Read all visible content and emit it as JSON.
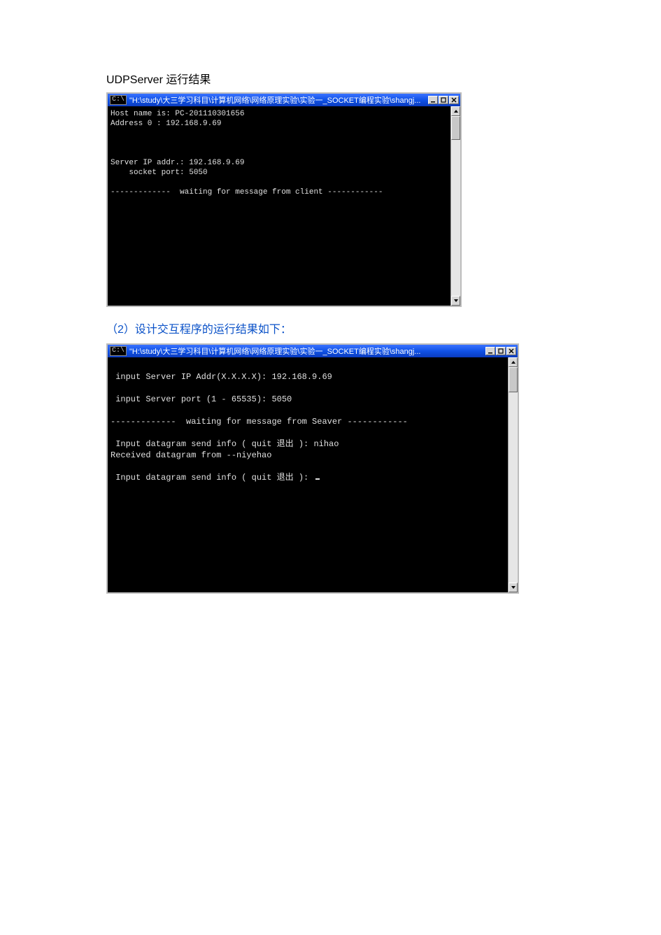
{
  "section1": {
    "caption": "UDPServer 运行结果",
    "titlebar": {
      "badge": "C:\\",
      "title": "\"H:\\study\\大三学习科目\\计算机网络\\网络原理实验\\实验一_SOCKET编程实验\\shangj..."
    },
    "lines": {
      "l0": "Host name is: PC-201110301656",
      "l1": "Address 0 : 192.168.9.69",
      "blank1": "",
      "blank2": "",
      "blank3": "",
      "l2": "Server IP addr.: 192.168.9.69",
      "l3": "    socket port: 5050",
      "blank4": "",
      "l4": "-------------  waiting for message from client ------------"
    }
  },
  "section2": {
    "caption": "（2）设计交互程序的运行结果如下：",
    "titlebar": {
      "badge": "C:\\",
      "title": "\"H:\\study\\大三学习科目\\计算机网络\\网络原理实验\\实验一_SOCKET编程实验\\shangj..."
    },
    "lines": {
      "blank0": "",
      "l0": " input Server IP Addr(X.X.X.X): 192.168.9.69",
      "blank1": "",
      "l1": " input Server port (1 - 65535): 5050",
      "blank2": "",
      "l2": "-------------  waiting for message from Seaver ------------",
      "blank3": "",
      "l3": " Input datagram send info ( quit 退出 ): nihao",
      "l4": "Received datagram from --niyehao",
      "blank4": "",
      "l5": " Input datagram send info ( quit 退出 ): "
    }
  }
}
